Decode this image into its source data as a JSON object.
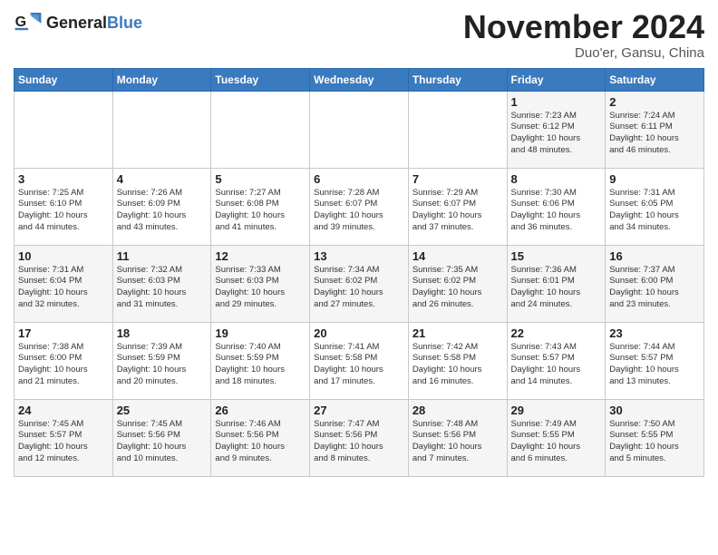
{
  "header": {
    "logo_line1": "General",
    "logo_line2": "Blue",
    "month": "November 2024",
    "location": "Duo'er, Gansu, China"
  },
  "days_of_week": [
    "Sunday",
    "Monday",
    "Tuesday",
    "Wednesday",
    "Thursday",
    "Friday",
    "Saturday"
  ],
  "weeks": [
    [
      {
        "day": "",
        "info": ""
      },
      {
        "day": "",
        "info": ""
      },
      {
        "day": "",
        "info": ""
      },
      {
        "day": "",
        "info": ""
      },
      {
        "day": "",
        "info": ""
      },
      {
        "day": "1",
        "info": "Sunrise: 7:23 AM\nSunset: 6:12 PM\nDaylight: 10 hours\nand 48 minutes."
      },
      {
        "day": "2",
        "info": "Sunrise: 7:24 AM\nSunset: 6:11 PM\nDaylight: 10 hours\nand 46 minutes."
      }
    ],
    [
      {
        "day": "3",
        "info": "Sunrise: 7:25 AM\nSunset: 6:10 PM\nDaylight: 10 hours\nand 44 minutes."
      },
      {
        "day": "4",
        "info": "Sunrise: 7:26 AM\nSunset: 6:09 PM\nDaylight: 10 hours\nand 43 minutes."
      },
      {
        "day": "5",
        "info": "Sunrise: 7:27 AM\nSunset: 6:08 PM\nDaylight: 10 hours\nand 41 minutes."
      },
      {
        "day": "6",
        "info": "Sunrise: 7:28 AM\nSunset: 6:07 PM\nDaylight: 10 hours\nand 39 minutes."
      },
      {
        "day": "7",
        "info": "Sunrise: 7:29 AM\nSunset: 6:07 PM\nDaylight: 10 hours\nand 37 minutes."
      },
      {
        "day": "8",
        "info": "Sunrise: 7:30 AM\nSunset: 6:06 PM\nDaylight: 10 hours\nand 36 minutes."
      },
      {
        "day": "9",
        "info": "Sunrise: 7:31 AM\nSunset: 6:05 PM\nDaylight: 10 hours\nand 34 minutes."
      }
    ],
    [
      {
        "day": "10",
        "info": "Sunrise: 7:31 AM\nSunset: 6:04 PM\nDaylight: 10 hours\nand 32 minutes."
      },
      {
        "day": "11",
        "info": "Sunrise: 7:32 AM\nSunset: 6:03 PM\nDaylight: 10 hours\nand 31 minutes."
      },
      {
        "day": "12",
        "info": "Sunrise: 7:33 AM\nSunset: 6:03 PM\nDaylight: 10 hours\nand 29 minutes."
      },
      {
        "day": "13",
        "info": "Sunrise: 7:34 AM\nSunset: 6:02 PM\nDaylight: 10 hours\nand 27 minutes."
      },
      {
        "day": "14",
        "info": "Sunrise: 7:35 AM\nSunset: 6:02 PM\nDaylight: 10 hours\nand 26 minutes."
      },
      {
        "day": "15",
        "info": "Sunrise: 7:36 AM\nSunset: 6:01 PM\nDaylight: 10 hours\nand 24 minutes."
      },
      {
        "day": "16",
        "info": "Sunrise: 7:37 AM\nSunset: 6:00 PM\nDaylight: 10 hours\nand 23 minutes."
      }
    ],
    [
      {
        "day": "17",
        "info": "Sunrise: 7:38 AM\nSunset: 6:00 PM\nDaylight: 10 hours\nand 21 minutes."
      },
      {
        "day": "18",
        "info": "Sunrise: 7:39 AM\nSunset: 5:59 PM\nDaylight: 10 hours\nand 20 minutes."
      },
      {
        "day": "19",
        "info": "Sunrise: 7:40 AM\nSunset: 5:59 PM\nDaylight: 10 hours\nand 18 minutes."
      },
      {
        "day": "20",
        "info": "Sunrise: 7:41 AM\nSunset: 5:58 PM\nDaylight: 10 hours\nand 17 minutes."
      },
      {
        "day": "21",
        "info": "Sunrise: 7:42 AM\nSunset: 5:58 PM\nDaylight: 10 hours\nand 16 minutes."
      },
      {
        "day": "22",
        "info": "Sunrise: 7:43 AM\nSunset: 5:57 PM\nDaylight: 10 hours\nand 14 minutes."
      },
      {
        "day": "23",
        "info": "Sunrise: 7:44 AM\nSunset: 5:57 PM\nDaylight: 10 hours\nand 13 minutes."
      }
    ],
    [
      {
        "day": "24",
        "info": "Sunrise: 7:45 AM\nSunset: 5:57 PM\nDaylight: 10 hours\nand 12 minutes."
      },
      {
        "day": "25",
        "info": "Sunrise: 7:45 AM\nSunset: 5:56 PM\nDaylight: 10 hours\nand 10 minutes."
      },
      {
        "day": "26",
        "info": "Sunrise: 7:46 AM\nSunset: 5:56 PM\nDaylight: 10 hours\nand 9 minutes."
      },
      {
        "day": "27",
        "info": "Sunrise: 7:47 AM\nSunset: 5:56 PM\nDaylight: 10 hours\nand 8 minutes."
      },
      {
        "day": "28",
        "info": "Sunrise: 7:48 AM\nSunset: 5:56 PM\nDaylight: 10 hours\nand 7 minutes."
      },
      {
        "day": "29",
        "info": "Sunrise: 7:49 AM\nSunset: 5:55 PM\nDaylight: 10 hours\nand 6 minutes."
      },
      {
        "day": "30",
        "info": "Sunrise: 7:50 AM\nSunset: 5:55 PM\nDaylight: 10 hours\nand 5 minutes."
      }
    ]
  ]
}
